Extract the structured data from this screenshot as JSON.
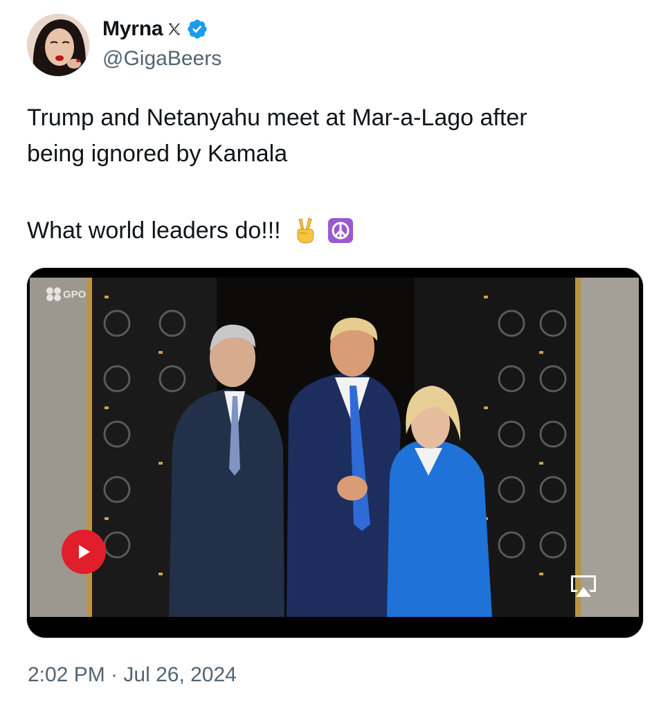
{
  "author": {
    "display_name": "Myrna",
    "handle": "@GigaBeers",
    "verified": true,
    "platform_icon": "x-logo-icon"
  },
  "tweet": {
    "line1": "Trump and Netanyahu meet at Mar-a-Lago after",
    "line2": "being ignored by Kamala",
    "line3": "What world leaders do!!!",
    "emojis": [
      "victory-hand-emoji",
      "peace-symbol-emoji"
    ]
  },
  "media": {
    "type": "video",
    "watermark": "GPO",
    "controls": [
      "play-icon",
      "airplay-icon"
    ]
  },
  "timestamp": "2:02 PM · Jul 26, 2024",
  "colors": {
    "text": "#0f1419",
    "secondary": "#536471",
    "verified": "#1d9bf0",
    "play": "#e01e2c",
    "peace_bg": "#9b59d0"
  }
}
